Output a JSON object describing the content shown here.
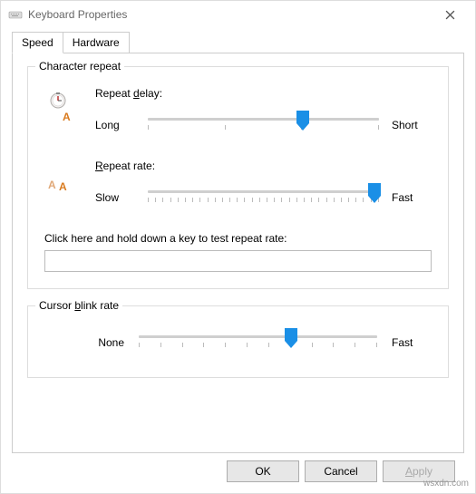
{
  "window": {
    "title": "Keyboard Properties"
  },
  "tabs": [
    {
      "label": "Speed",
      "active": true
    },
    {
      "label": "Hardware",
      "active": false
    }
  ],
  "char_repeat": {
    "group_label": "Character repeat",
    "delay": {
      "label_pre": "Repeat ",
      "label_u": "d",
      "label_post": "elay:",
      "min": "Long",
      "max": "Short",
      "value_pct": 67
    },
    "rate": {
      "label_u": "R",
      "label_post": "epeat rate:",
      "min": "Slow",
      "max": "Fast",
      "value_pct": 98
    },
    "test_label": "Click here and hold down a key to test repeat rate:",
    "test_value": ""
  },
  "cursor": {
    "group_label_pre": "Cursor ",
    "group_label_u": "b",
    "group_label_post": "link rate",
    "none": "None",
    "fast": "Fast",
    "value_pct": 64
  },
  "buttons": {
    "ok": "OK",
    "cancel": "Cancel",
    "apply_u": "A",
    "apply_post": "pply"
  },
  "watermark": "wsxdn.com"
}
